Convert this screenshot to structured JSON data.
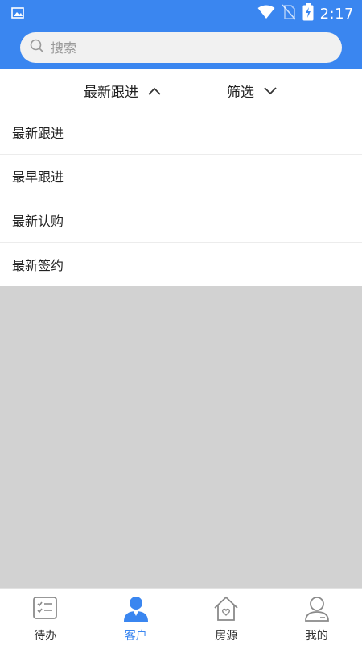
{
  "status_bar": {
    "time": "2:17",
    "icons": [
      "image-icon",
      "wifi-icon",
      "no-sim-icon",
      "battery-charging-icon"
    ]
  },
  "search": {
    "placeholder": "搜索",
    "icon": "search-icon"
  },
  "filter_bar": {
    "sort_label": "最新跟进",
    "sort_icon": "chevron-up-icon",
    "filter_label": "筛选",
    "filter_icon": "chevron-down-icon"
  },
  "sort_options": [
    {
      "label": "最新跟进"
    },
    {
      "label": "最早跟进"
    },
    {
      "label": "最新认购"
    },
    {
      "label": "最新签约"
    }
  ],
  "bottom_nav": {
    "items": [
      {
        "label": "待办",
        "icon": "todo-list-icon",
        "active": false
      },
      {
        "label": "客户",
        "icon": "customer-person-icon",
        "active": true
      },
      {
        "label": "房源",
        "icon": "house-heart-icon",
        "active": false
      },
      {
        "label": "我的",
        "icon": "profile-person-icon",
        "active": false
      }
    ]
  },
  "colors": {
    "accent": "#3a86f0",
    "overlay": "#d2d2d2",
    "nav_inactive_icon": "#8a8a8a"
  }
}
